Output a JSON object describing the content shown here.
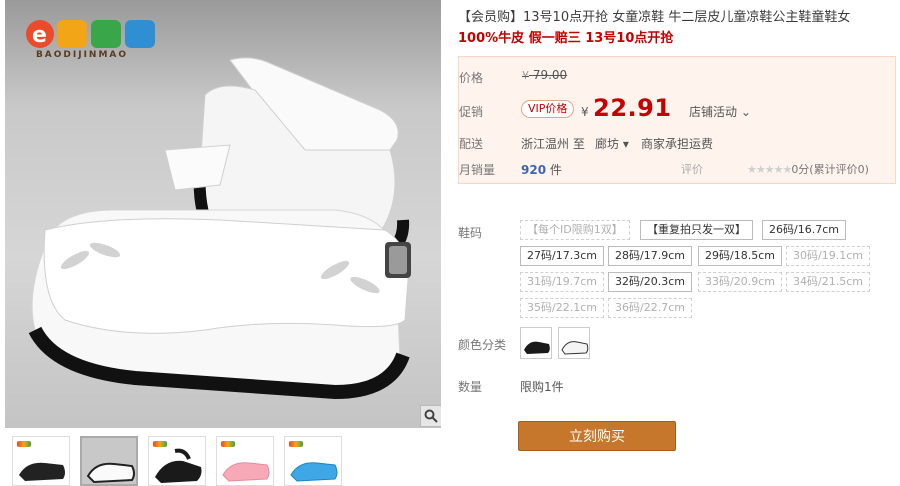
{
  "logo": {
    "brand_text": "BAODIJINMAO"
  },
  "product": {
    "title": "【会员购】13号10点开抢 女童凉鞋 牛二层皮儿童凉鞋公主鞋童鞋女",
    "subtitle": "100%牛皮 假一赔三 13号10点开抢"
  },
  "price": {
    "label": "价格",
    "currency": "¥",
    "original": "79.00",
    "promo_label": "促销",
    "vip_badge": "VIP价格",
    "promo_price": "22.91",
    "shop_activity": "店铺活动 ⌄"
  },
  "shipping": {
    "label": "配送",
    "from": "浙江温州  至",
    "to": "廊坊 ▾",
    "freight": "商家承担运费"
  },
  "sales": {
    "label": "月销量",
    "count": "920",
    "unit": "件",
    "rating_label": "评价",
    "stars": "★★★★★",
    "rating_text": "0分(累计评价0)"
  },
  "sizes": {
    "label": "鞋码",
    "options": [
      {
        "text": "【每个ID限购1双】",
        "enabled": false
      },
      {
        "text": "【重复拍只发一双】",
        "enabled": true
      },
      {
        "text": "26码/16.7cm",
        "enabled": true
      },
      {
        "text": "27码/17.3cm",
        "enabled": true
      },
      {
        "text": "28码/17.9cm",
        "enabled": true
      },
      {
        "text": "29码/18.5cm",
        "enabled": true
      },
      {
        "text": "30码/19.1cm",
        "enabled": false
      },
      {
        "text": "31码/19.7cm",
        "enabled": false
      },
      {
        "text": "32码/20.3cm",
        "enabled": true
      },
      {
        "text": "33码/20.9cm",
        "enabled": false
      },
      {
        "text": "34码/21.5cm",
        "enabled": false
      },
      {
        "text": "35码/22.1cm",
        "enabled": false
      },
      {
        "text": "36码/22.7cm",
        "enabled": false
      }
    ]
  },
  "color": {
    "label": "颜色分类"
  },
  "quantity": {
    "label": "数量",
    "value": "限购1件"
  },
  "buy_button": "立刻购买",
  "colors": {
    "accent": "#c40000",
    "buy": "#c7772c",
    "price_bg": "#fff3ee"
  }
}
